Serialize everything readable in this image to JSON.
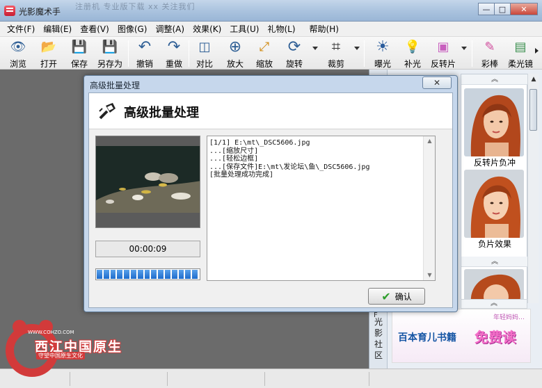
{
  "window": {
    "title": "光影魔术手",
    "ghost_title": "注册机   专业版下载   xx   关注我们",
    "min_glyph": "—",
    "max_glyph": "□",
    "close_glyph": "✕"
  },
  "menu": [
    "文件(F)",
    "编辑(E)",
    "查看(V)",
    "图像(G)",
    "调整(A)",
    "效果(K)",
    "工具(U)",
    "礼物(L)",
    "帮助(H)"
  ],
  "toolbar": [
    {
      "label": "浏览",
      "icon": "eye-icon",
      "glyph": "👁"
    },
    {
      "label": "打开",
      "icon": "folder-open-icon",
      "glyph": "📂"
    },
    {
      "label": "保存",
      "icon": "save-icon",
      "glyph": "💾"
    },
    {
      "label": "另存为",
      "icon": "save-as-icon",
      "glyph": "💾"
    },
    {
      "label": "撤销",
      "icon": "undo-icon",
      "glyph": "↶"
    },
    {
      "label": "重做",
      "icon": "redo-icon",
      "glyph": "↷"
    },
    {
      "label": "对比",
      "icon": "compare-icon",
      "glyph": "◫"
    },
    {
      "label": "放大",
      "icon": "zoom-in-icon",
      "glyph": "⊕"
    },
    {
      "label": "缩放",
      "icon": "resize-icon",
      "glyph": "⤢"
    },
    {
      "label": "旋转",
      "icon": "rotate-icon",
      "glyph": "⟳"
    },
    {
      "label": "裁剪",
      "icon": "crop-icon",
      "glyph": "⌗"
    },
    {
      "label": "曝光",
      "icon": "exposure-icon",
      "glyph": "☀"
    },
    {
      "label": "补光",
      "icon": "fill-light-icon",
      "glyph": "💡"
    },
    {
      "label": "反转片",
      "icon": "reversal-film-icon",
      "glyph": "▣"
    },
    {
      "label": "彩棒",
      "icon": "color-wand-icon",
      "glyph": "✎"
    },
    {
      "label": "柔光镜",
      "icon": "soft-light-icon",
      "glyph": "▤"
    }
  ],
  "dialog": {
    "title": "高级批量处理",
    "header": "高级批量处理",
    "close_glyph": "✕",
    "time": "00:00:09",
    "progress": 1.0,
    "log": [
      "[1/1] E:\\mt\\_DSC5606.jpg",
      "...[缩放尺寸]",
      "...[轻松边框]",
      "...[保存文件]E:\\mt\\发论坛\\鱼\\_DSC5606.jpg",
      "[批量处理成功完成]"
    ],
    "ok_label": "确认"
  },
  "side_panel": {
    "effects": [
      {
        "label": "反转片负冲"
      },
      {
        "label": "负片效果"
      }
    ],
    "side_text": "光影社区",
    "side_letter": "F",
    "up_glyph": "︽"
  },
  "ad": {
    "top_text": "年轻妈妈…",
    "main_text": "百本育儿书籍",
    "free_text": "免费读"
  },
  "watermark": {
    "text": "西江中国原生",
    "sub": "守望中国原生文化",
    "url": "WWW.COHZO.COM"
  }
}
